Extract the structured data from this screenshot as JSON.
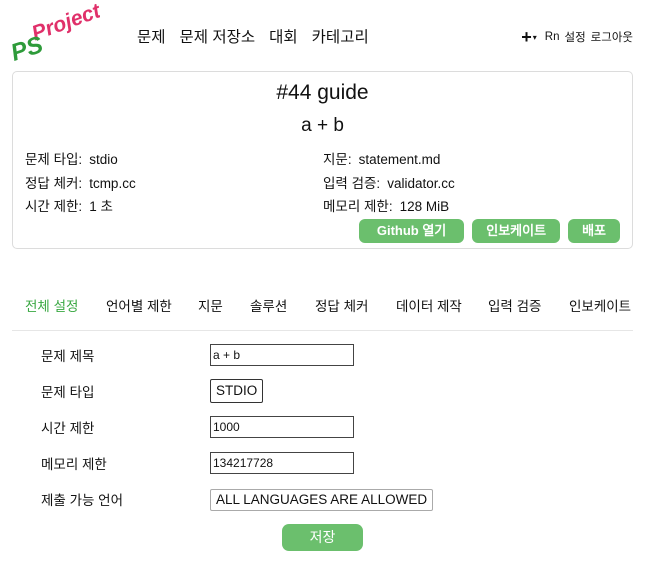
{
  "logo": {
    "text_top": "Project",
    "text_bottom": "PS"
  },
  "nav": {
    "items": [
      {
        "label": "문제"
      },
      {
        "label": "문제 저장소"
      },
      {
        "label": "대회"
      },
      {
        "label": "카테고리"
      }
    ]
  },
  "header": {
    "plus": "+",
    "caret": "▾",
    "user": "Rn",
    "settings": "설정",
    "logout": "로그아웃"
  },
  "card": {
    "id": "#44 guide",
    "name": "a + b",
    "info": {
      "type_label": "문제 타입:",
      "type_value": "stdio",
      "checker_label": "정답 체커:",
      "checker_value": "tcmp.cc",
      "time_label": "시간 제한:",
      "time_value": "1 초",
      "statement_label": "지문:",
      "statement_value": "statement.md",
      "validator_label": "입력 검증:",
      "validator_value": "validator.cc",
      "memory_label": "메모리 제한:",
      "memory_value": "128 MiB"
    },
    "buttons": {
      "github": "Github 열기",
      "invoke": "인보케이트",
      "deploy": "배포"
    }
  },
  "tabs": {
    "active": "전체 설정",
    "items": [
      {
        "label": "전체 설정"
      },
      {
        "label": "언어별 제한"
      },
      {
        "label": "지문"
      },
      {
        "label": "솔루션"
      },
      {
        "label": "정답 체커"
      },
      {
        "label": "데이터 제작"
      },
      {
        "label": "입력 검증"
      },
      {
        "label": "인보케이트"
      }
    ]
  },
  "form": {
    "title_label": "문제 제목",
    "title_value": "a + b",
    "type_label": "문제 타입",
    "type_value": "STDIO",
    "time_label": "시간 제한",
    "time_value": "1000",
    "memory_label": "메모리 제한",
    "memory_value": "134217728",
    "lang_label": "제출 가능 언어",
    "lang_value": "ALL LANGUAGES ARE ALLOWED",
    "save_label": "저장"
  },
  "colors": {
    "accent_green": "#6bbf6d",
    "active_tab": "#3aa843",
    "logo_green": "#2e9b3a",
    "logo_pink": "#e0306a"
  }
}
